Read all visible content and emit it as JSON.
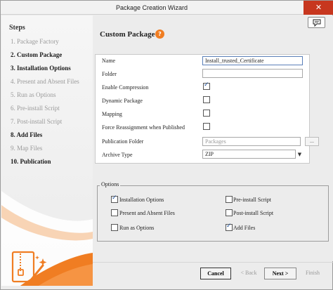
{
  "window": {
    "title": "Package Creation Wizard",
    "close_glyph": "✕"
  },
  "sidebar": {
    "heading": "Steps",
    "steps": [
      {
        "label": "1. Package Factory",
        "bold": false
      },
      {
        "label": "2. Custom Package",
        "bold": true
      },
      {
        "label": "3. Installation Options",
        "bold": true
      },
      {
        "label": "4. Present and Absent Files",
        "bold": false
      },
      {
        "label": "5. Run as Options",
        "bold": false
      },
      {
        "label": "6. Pre-install Script",
        "bold": false
      },
      {
        "label": "7. Post-install Script",
        "bold": false
      },
      {
        "label": "8. Add Files",
        "bold": true
      },
      {
        "label": "9. Map Files",
        "bold": false
      },
      {
        "label": "10. Publication",
        "bold": true
      }
    ]
  },
  "main": {
    "title": "Custom Package",
    "help_glyph": "?",
    "form": {
      "name_label": "Name",
      "name_value": "Install_trusted_Certificate",
      "folder_label": "Folder",
      "folder_value": "",
      "enable_compression_label": "Enable Compression",
      "enable_compression_checked": true,
      "dynamic_package_label": "Dynamic Package",
      "dynamic_package_checked": false,
      "mapping_label": "Mapping",
      "mapping_checked": false,
      "force_reassignment_label": "Force Reassignment when Published",
      "force_reassignment_checked": false,
      "publication_folder_label": "Publication Folder",
      "publication_folder_placeholder": "Packages",
      "browse_label": "...",
      "archive_type_label": "Archive Type",
      "archive_type_value": "ZIP"
    },
    "options": {
      "legend": "Options",
      "items": [
        {
          "label": "Installation Options",
          "checked": true
        },
        {
          "label": "Pre-install Script",
          "checked": false
        },
        {
          "label": "Present and Absent Files",
          "checked": false
        },
        {
          "label": "Post-install Script",
          "checked": false
        },
        {
          "label": "Run as Options",
          "checked": false
        },
        {
          "label": "Add Files",
          "checked": true
        }
      ]
    }
  },
  "footer": {
    "cancel": "Cancel",
    "back": "< Back",
    "next": "Next >",
    "finish": "Finish"
  },
  "colors": {
    "accent": "#f07d22",
    "close": "#c7371f",
    "check": "#1a4e9a"
  },
  "icons": [
    "close-icon",
    "chat-icon",
    "help-icon",
    "dropdown-arrow-icon",
    "zip-wand-icon"
  ]
}
